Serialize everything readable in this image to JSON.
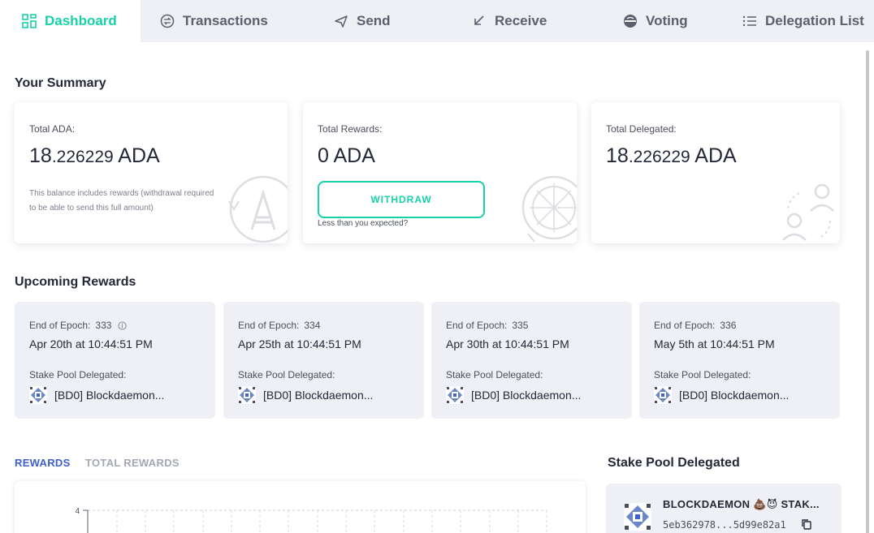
{
  "nav": {
    "tabs": [
      {
        "label": "Dashboard",
        "icon": "dashboard-icon",
        "active": true
      },
      {
        "label": "Transactions",
        "icon": "transactions-icon",
        "active": false
      },
      {
        "label": "Send",
        "icon": "send-icon",
        "active": false
      },
      {
        "label": "Receive",
        "icon": "receive-icon",
        "active": false
      },
      {
        "label": "Voting",
        "icon": "voting-icon",
        "active": false
      },
      {
        "label": "Delegation List",
        "icon": "delegation-list-icon",
        "active": false
      }
    ]
  },
  "summary": {
    "title": "Your Summary",
    "total_ada": {
      "label": "Total ADA:",
      "int": "18",
      "dec": ".226229",
      "unit": " ADA",
      "note": "This balance includes rewards (withdrawal required to be able to send this full amount)"
    },
    "total_rewards": {
      "label": "Total Rewards:",
      "amount": "0 ADA",
      "button": "WITHDRAW",
      "link": "Less than you expected?"
    },
    "total_delegated": {
      "label": "Total Delegated:",
      "int": "18",
      "dec": ".226229",
      "unit": " ADA"
    }
  },
  "upcoming": {
    "title": "Upcoming Rewards",
    "items": [
      {
        "label": "End of Epoch:",
        "epoch": "333",
        "date": "Apr 20th at 10:44:51 PM",
        "pool_label": "Stake Pool Delegated:",
        "pool": "[BD0] Blockdaemon..."
      },
      {
        "label": "End of Epoch:",
        "epoch": "334",
        "date": "Apr 25th at 10:44:51 PM",
        "pool_label": "Stake Pool Delegated:",
        "pool": "[BD0] Blockdaemon..."
      },
      {
        "label": "End of Epoch:",
        "epoch": "335",
        "date": "Apr 30th at 10:44:51 PM",
        "pool_label": "Stake Pool Delegated:",
        "pool": "[BD0] Blockdaemon..."
      },
      {
        "label": "End of Epoch:",
        "epoch": "336",
        "date": "May 5th at 10:44:51 PM",
        "pool_label": "Stake Pool Delegated:",
        "pool": "[BD0] Blockdaemon..."
      }
    ]
  },
  "rewards_tabs": {
    "rewards": "REWARDS",
    "total_rewards": "TOTAL REWARDS"
  },
  "chart": {
    "y_tick_top": "4"
  },
  "stake_pool": {
    "title": "Stake Pool Delegated",
    "name": "BLOCKDAEMON 💩😈 STAK...",
    "hash": "5eb362978...5d99e82a1"
  },
  "colors": {
    "accent": "#17d1aa",
    "tab_active_blue": "#3d60cd",
    "panel_bg": "#eef0f5"
  }
}
